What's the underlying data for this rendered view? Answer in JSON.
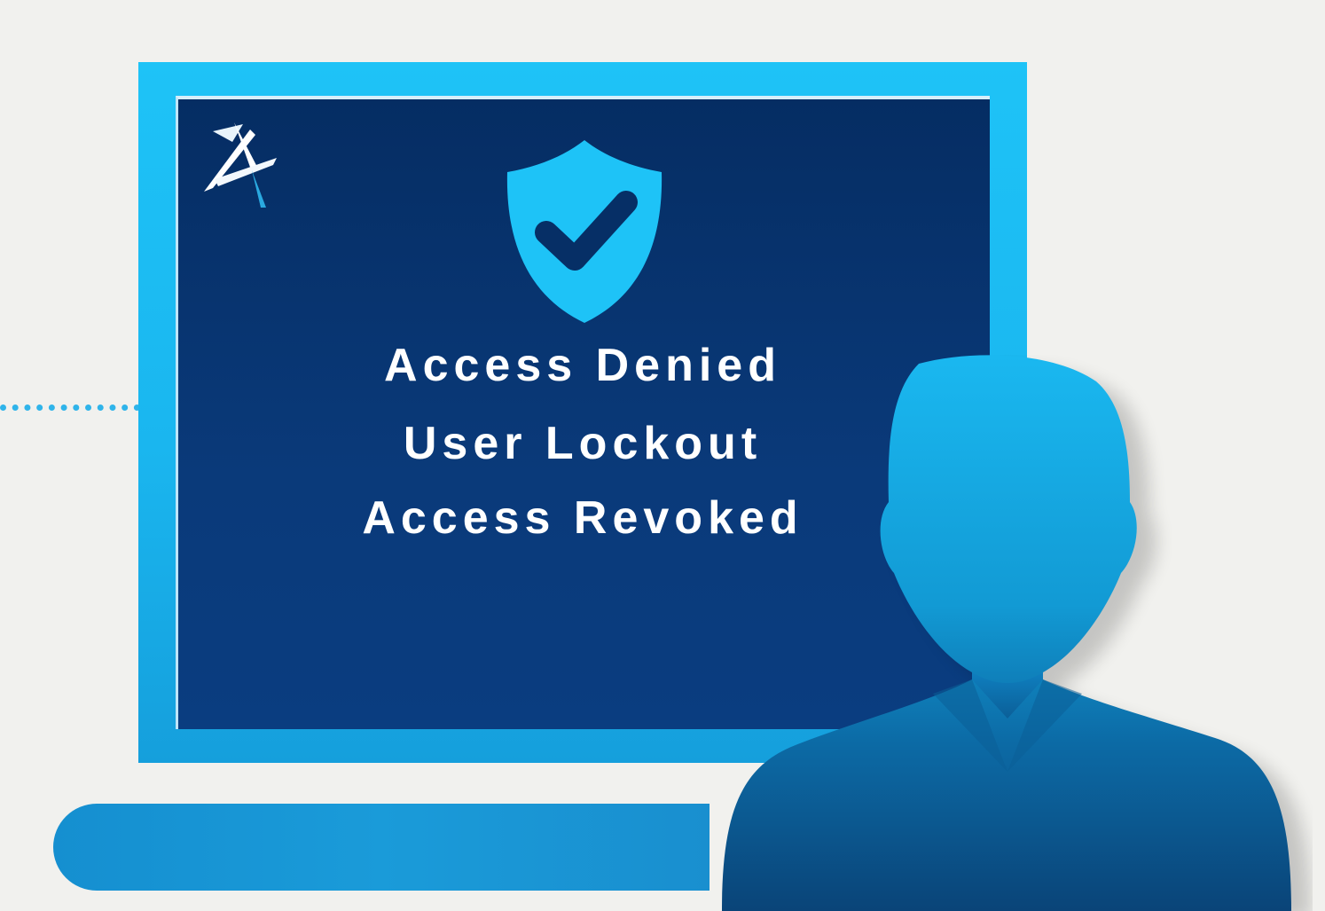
{
  "screen": {
    "messages": [
      "Access Denied",
      "User Lockout",
      "Access Revoked"
    ]
  },
  "icons": {
    "logo": "stylized-a-logo-icon",
    "shield": "shield-check-icon",
    "person": "user-silhouette-icon"
  },
  "colors": {
    "background": "#f1f1ee",
    "monitor_frame": "#1ec3f7",
    "screen": "#052d63",
    "shield": "#1ec3f7",
    "text": "#ffffff",
    "person_top": "#1ab6ef",
    "person_bottom": "#0b4578"
  }
}
